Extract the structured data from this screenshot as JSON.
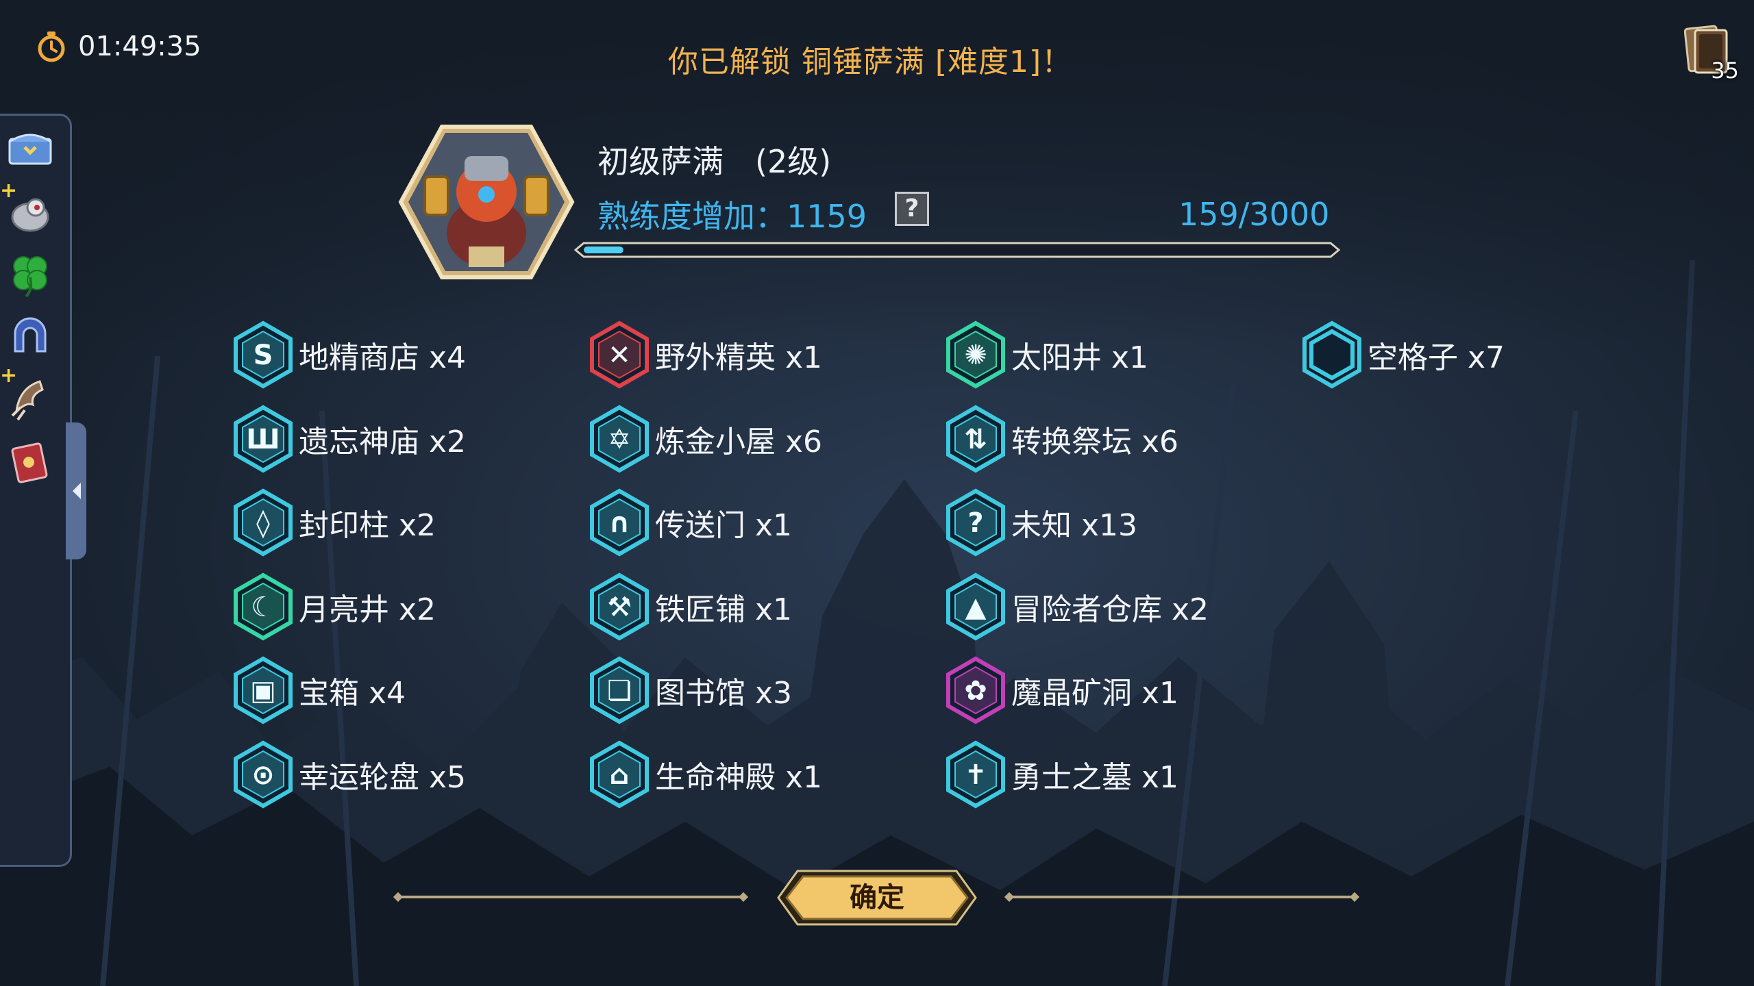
{
  "timer": {
    "time": "01:49:35"
  },
  "banner": {
    "text": "你已解锁 铜锤萨满 [难度1]！"
  },
  "deck": {
    "count": "35"
  },
  "sidebar": {
    "items": [
      {
        "icon": "treasure-chest-icon"
      },
      {
        "icon": "robot-pet-icon",
        "badge": "+"
      },
      {
        "icon": "four-leaf-clover-icon"
      },
      {
        "icon": "horseshoe-magnet-icon"
      },
      {
        "icon": "claw-icon",
        "badge": "+"
      },
      {
        "icon": "spellbook-icon"
      }
    ]
  },
  "hero": {
    "name": "初级萨满　(2级)",
    "exp_label": "熟练度增加：1159",
    "help": "?",
    "exp_value": "159/3000",
    "exp_progress": 0.053
  },
  "rewards": {
    "col1": [
      {
        "label": "地精商店 x4",
        "icon": "goblin-shop-icon",
        "color": "#3ec9e0"
      },
      {
        "label": "遗忘神庙 x2",
        "icon": "forgotten-temple-icon",
        "color": "#3ec9e0"
      },
      {
        "label": "封印柱 x2",
        "icon": "seal-pillar-icon",
        "color": "#3ec9e0"
      },
      {
        "label": "月亮井 x2",
        "icon": "moon-well-icon",
        "color": "#36d7a3"
      },
      {
        "label": "宝箱 x4",
        "icon": "treasure-box-icon",
        "color": "#3ec9e0"
      },
      {
        "label": "幸运轮盘 x5",
        "icon": "lucky-wheel-icon",
        "color": "#3ec9e0"
      }
    ],
    "col2": [
      {
        "label": "野外精英 x1",
        "icon": "field-elite-icon",
        "color": "#e0414a"
      },
      {
        "label": "炼金小屋 x6",
        "icon": "alchemy-hut-icon",
        "color": "#3ec9e0"
      },
      {
        "label": "传送门 x1",
        "icon": "portal-icon",
        "color": "#3ec9e0"
      },
      {
        "label": "铁匠铺 x1",
        "icon": "blacksmith-icon",
        "color": "#3ec9e0"
      },
      {
        "label": "图书馆 x3",
        "icon": "library-icon",
        "color": "#3ec9e0"
      },
      {
        "label": "生命神殿 x1",
        "icon": "life-shrine-icon",
        "color": "#3ec9e0"
      }
    ],
    "col3": [
      {
        "label": "太阳井 x1",
        "icon": "sun-well-icon",
        "color": "#36d7a3"
      },
      {
        "label": "转换祭坛 x6",
        "icon": "conversion-altar-icon",
        "color": "#3ec9e0"
      },
      {
        "label": "未知 x13",
        "icon": "unknown-question-icon",
        "color": "#3ec9e0"
      },
      {
        "label": "冒险者仓库 x2",
        "icon": "adventurer-warehouse-icon",
        "color": "#3ec9e0"
      },
      {
        "label": "魔晶矿洞 x1",
        "icon": "magic-crystal-mine-icon",
        "color": "#c23fb8"
      },
      {
        "label": "勇士之墓 x1",
        "icon": "warrior-tomb-icon",
        "color": "#3ec9e0"
      }
    ],
    "col4": [
      {
        "label": "空格子 x7",
        "icon": "empty-hexagon-icon",
        "color": "#3ec9e0"
      }
    ]
  },
  "confirm": {
    "label": "确定"
  },
  "colors": {
    "banner": "#f3b24f",
    "exp": "#3fb6ee",
    "accent_cyan": "#3ec9e0",
    "button_gold": "#f2c66a"
  }
}
